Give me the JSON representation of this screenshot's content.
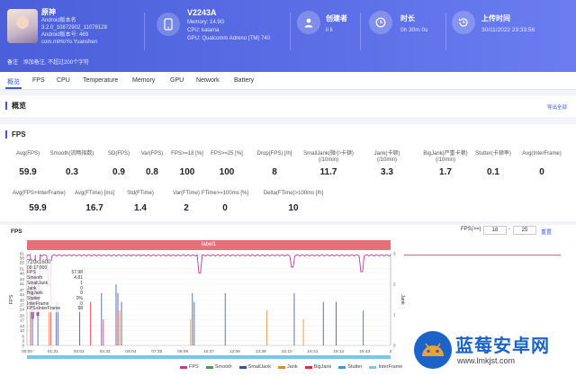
{
  "header": {
    "top_note": "",
    "app": {
      "name": "原神",
      "lines": [
        "Android版本名",
        "3.2.0_10872902_11078128",
        "Android版本号: 469",
        "com.miHoYo.Yuanshen"
      ]
    },
    "device": {
      "name": "V2243A",
      "lines": [
        "Memory: 14.9G",
        "CPU: kalama",
        "GPU: Qualcomm Adreno (TM) 740"
      ]
    },
    "creator": {
      "title": "创建者",
      "value": "li li"
    },
    "duration": {
      "title": "时长",
      "value": "0h 30m 0s"
    },
    "upload": {
      "title": "上传时间",
      "value": "30/11/2022 23:33:56"
    },
    "remark": {
      "label": "备注",
      "value": "添加备注, 不超过200个字符"
    }
  },
  "tabs": [
    "概览",
    "FPS",
    "CPU",
    "Temperature",
    "Memory",
    "GPU",
    "Network",
    "Battery"
  ],
  "overview": {
    "title": "概览",
    "export": "导出全部"
  },
  "fps_section": {
    "title": "FPS",
    "row1": [
      {
        "label": "Avg(FPS)",
        "value": "59.9"
      },
      {
        "label": "Smooth(流畅指数)",
        "value": "0.3"
      },
      {
        "label": "SD(FPS)",
        "value": "0.9"
      },
      {
        "label": "Var(FPS)",
        "value": "0.8"
      },
      {
        "label": "FPS>=18 [%]",
        "value": "100"
      },
      {
        "label": "FPS>=25 [%]",
        "value": "100"
      },
      {
        "label": "Drop(FPS) [/h]",
        "value": "8"
      },
      {
        "label": "SmallJank(微小卡顿)\n(/10min)",
        "value": "11.7"
      },
      {
        "label": "Jank(卡顿)\n(/10min)",
        "value": "3.3"
      },
      {
        "label": "BigJank(严重卡顿)\n(/10min)",
        "value": "1.7"
      },
      {
        "label": "Stutter(卡顿率)",
        "value": "0.1"
      },
      {
        "label": "Avg(InterFrame)",
        "value": "0"
      }
    ],
    "row2": [
      {
        "label": "Avg(FPS+InterFrame)",
        "value": "59.9"
      },
      {
        "label": "Avg(FTime) [ms]",
        "value": "16.7"
      },
      {
        "label": "Std(FTime)",
        "value": "1.4"
      },
      {
        "label": "Var(FTime)",
        "value": "2"
      },
      {
        "label": "FTime>=100ms [%]",
        "value": "0"
      },
      {
        "label": "Delta(FTime)>100ms [/h]",
        "value": "10"
      }
    ]
  },
  "chart_panel": {
    "label": "FPS",
    "range_label": "FPS(>=)",
    "range_from": "18",
    "range_to": "25",
    "reset": "重置",
    "band_label": "label1",
    "y_axis_label": "FPS",
    "y2_axis_label": "Jank",
    "tooltip": {
      "header": "720x1600",
      "time": "00:17:000",
      "rows": [
        [
          "FPS",
          "57.98"
        ],
        [
          "Smooth",
          "4.81"
        ],
        [
          "SmallJank",
          "1"
        ],
        [
          "Jank",
          "0"
        ],
        [
          "BigJank",
          "0"
        ],
        [
          "Stutter",
          "0%"
        ],
        [
          "InterFrame",
          "0"
        ],
        [
          "FPS+InterFrame",
          "58"
        ]
      ]
    }
  },
  "chart_data": {
    "type": "line",
    "x_ticks": [
      "00:00",
      "01:31",
      "03:02",
      "04:33",
      "06:04",
      "07:35",
      "09:06",
      "10:37",
      "12:08",
      "13:39",
      "15:10",
      "16:41",
      "18:12",
      "19:43",
      "2"
    ],
    "y_ticks": [
      "61",
      "58",
      "55",
      "51",
      "48",
      "44",
      "41",
      "37",
      "34",
      "30",
      "27",
      "24",
      "20",
      "17",
      "13",
      "10",
      "6",
      "3",
      "0"
    ],
    "y2_ticks": [
      "3",
      "2",
      "1",
      "0"
    ],
    "ylim": [
      0,
      61
    ],
    "series": [
      {
        "name": "FPS",
        "color": "#c03a8f",
        "baseline": 60,
        "dips": [
          [
            0.3,
            18
          ],
          [
            0.6,
            20
          ],
          [
            1.2,
            40
          ],
          [
            9.5,
            48
          ],
          [
            14.6,
            52
          ],
          [
            18.4,
            49
          ]
        ]
      },
      {
        "name": "Smooth",
        "color": "#4aa04a"
      },
      {
        "name": "SmallJank",
        "color": "#3b4fa8",
        "spikes": [
          [
            0.3,
            0.8
          ],
          [
            0.6,
            0.7
          ],
          [
            1.6,
            0.5
          ],
          [
            1.7,
            0.5
          ],
          [
            2.9,
            0.5
          ],
          [
            4.1,
            0.6
          ],
          [
            4.9,
            0.7
          ],
          [
            5.0,
            0.6
          ],
          [
            5.2,
            0.5
          ],
          [
            9.1,
            0.6
          ],
          [
            9.2,
            0.5
          ],
          [
            10.9,
            0.6
          ],
          [
            14.7,
            0.6
          ],
          [
            16.3,
            0.5
          ],
          [
            17.0,
            0.5
          ],
          [
            18.5,
            0.4
          ]
        ]
      },
      {
        "name": "Jank",
        "color": "#e08a2a",
        "spikes": [
          [
            1.2,
            0.4
          ],
          [
            5.1,
            0.4
          ],
          [
            9.0,
            0.3
          ],
          [
            13.2,
            0.4
          ],
          [
            15.2,
            0.3
          ]
        ]
      },
      {
        "name": "BigJank",
        "color": "#d9303a",
        "spikes": [
          [
            0.2,
            1.0
          ],
          [
            1.3,
            0.7
          ],
          [
            3.5,
            0.5
          ],
          [
            4.2,
            0.3
          ],
          [
            5.0,
            0.4
          ]
        ]
      },
      {
        "name": "Stutter",
        "color": "#3a9ad9"
      },
      {
        "name": "InterFrame",
        "color": "#7bc8e6"
      }
    ],
    "x_range_minutes": [
      0,
      20
    ]
  },
  "watermark": {
    "text": "蓝莓安卓网",
    "url": "www.lmkjst.com"
  }
}
